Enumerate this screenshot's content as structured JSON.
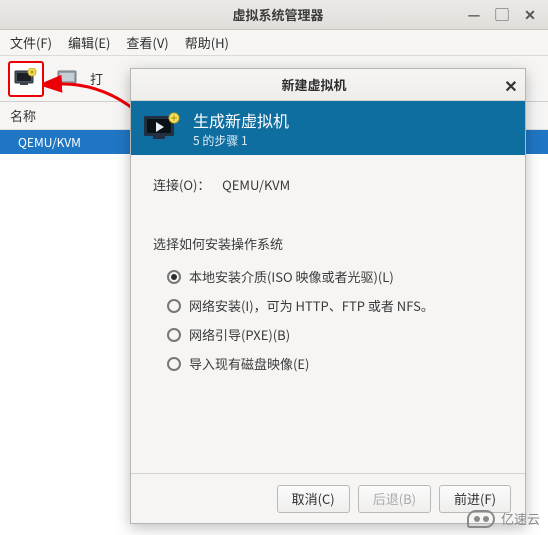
{
  "main_window": {
    "title": "虚拟系统管理器",
    "win_min": "—",
    "win_max": "▢",
    "win_close": "✕",
    "menu": {
      "file": "文件(F)",
      "edit": "编辑(E)",
      "view": "查看(V)",
      "help": "帮助(H)"
    },
    "toolbar": {
      "open_label": "打"
    },
    "col_name": "名称",
    "vm_list": {
      "items": [
        {
          "name": "QEMU/KVM"
        }
      ]
    }
  },
  "modal": {
    "title": "新建虚拟机",
    "close_glyph": "✕",
    "header": {
      "heading": "生成新虚拟机",
      "step": "5 的步骤 1"
    },
    "body": {
      "connection_label": "连接(O)：",
      "connection_value": "QEMU/KVM",
      "section_label": "选择如何安装操作系统",
      "options": [
        {
          "label": "本地安装介质(ISO 映像或者光驱)(L)",
          "selected": true
        },
        {
          "label": "网络安装(I)，可为 HTTP、FTP 或者 NFS。",
          "selected": false
        },
        {
          "label": "网络引导(PXE)(B)",
          "selected": false
        },
        {
          "label": "导入现有磁盘映像(E)",
          "selected": false
        }
      ]
    },
    "footer": {
      "cancel": "取消(C)",
      "back": "后退(B)",
      "forward": "前进(F)"
    }
  },
  "watermark": "亿速云"
}
